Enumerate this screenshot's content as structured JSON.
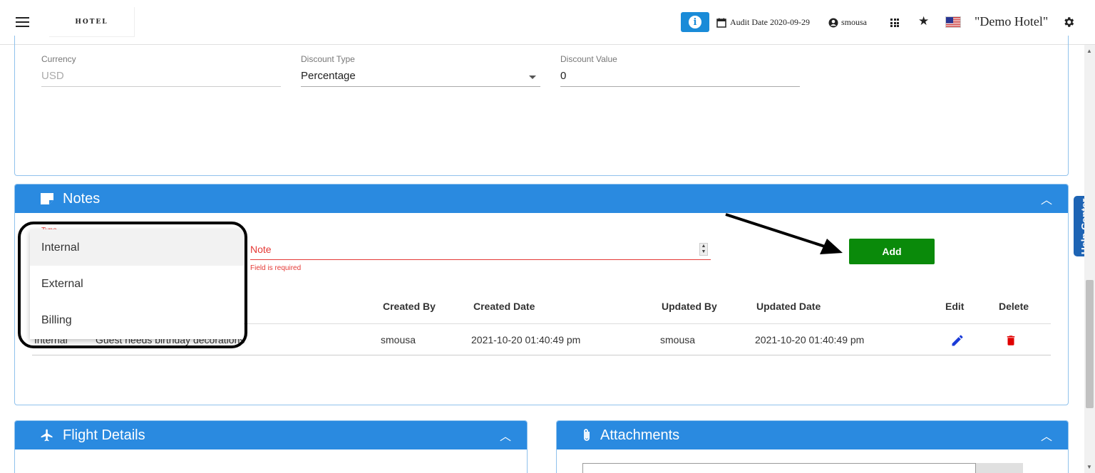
{
  "header": {
    "logo_text": "HOTEL",
    "audit_date": "Audit Date 2020-09-29",
    "username": "smousa",
    "hotel_name": "\"Demo Hotel\""
  },
  "help_center": "Help Center",
  "discount": {
    "currency_label": "Currency",
    "currency_value": "USD",
    "discount_type_label": "Discount Type",
    "discount_type_value": "Percentage",
    "discount_value_label": "Discount Value",
    "discount_value": "0"
  },
  "notes": {
    "title": "Notes",
    "type_label": "Type",
    "type_options": [
      "Internal",
      "External",
      "Billing"
    ],
    "note_placeholder": "Note",
    "error": "Field is required",
    "add_label": "Add",
    "columns": [
      "Created By",
      "Created Date",
      "Updated By",
      "Updated Date",
      "Edit",
      "Delete"
    ],
    "rows": [
      {
        "type": "Internal",
        "note": "Guest needs birthday decorations",
        "created_by": "smousa",
        "created_date": "2021-10-20 01:40:49 pm",
        "updated_by": "smousa",
        "updated_date": "2021-10-20 01:40:49 pm"
      }
    ]
  },
  "flight": {
    "title": "Flight Details"
  },
  "attachments": {
    "title": "Attachments"
  },
  "colors": {
    "section_header": "#2a8ae0",
    "add_button": "#0a8a0a",
    "error": "#e53935",
    "edit_icon": "#1a3bd8",
    "delete_icon": "#e00000"
  }
}
